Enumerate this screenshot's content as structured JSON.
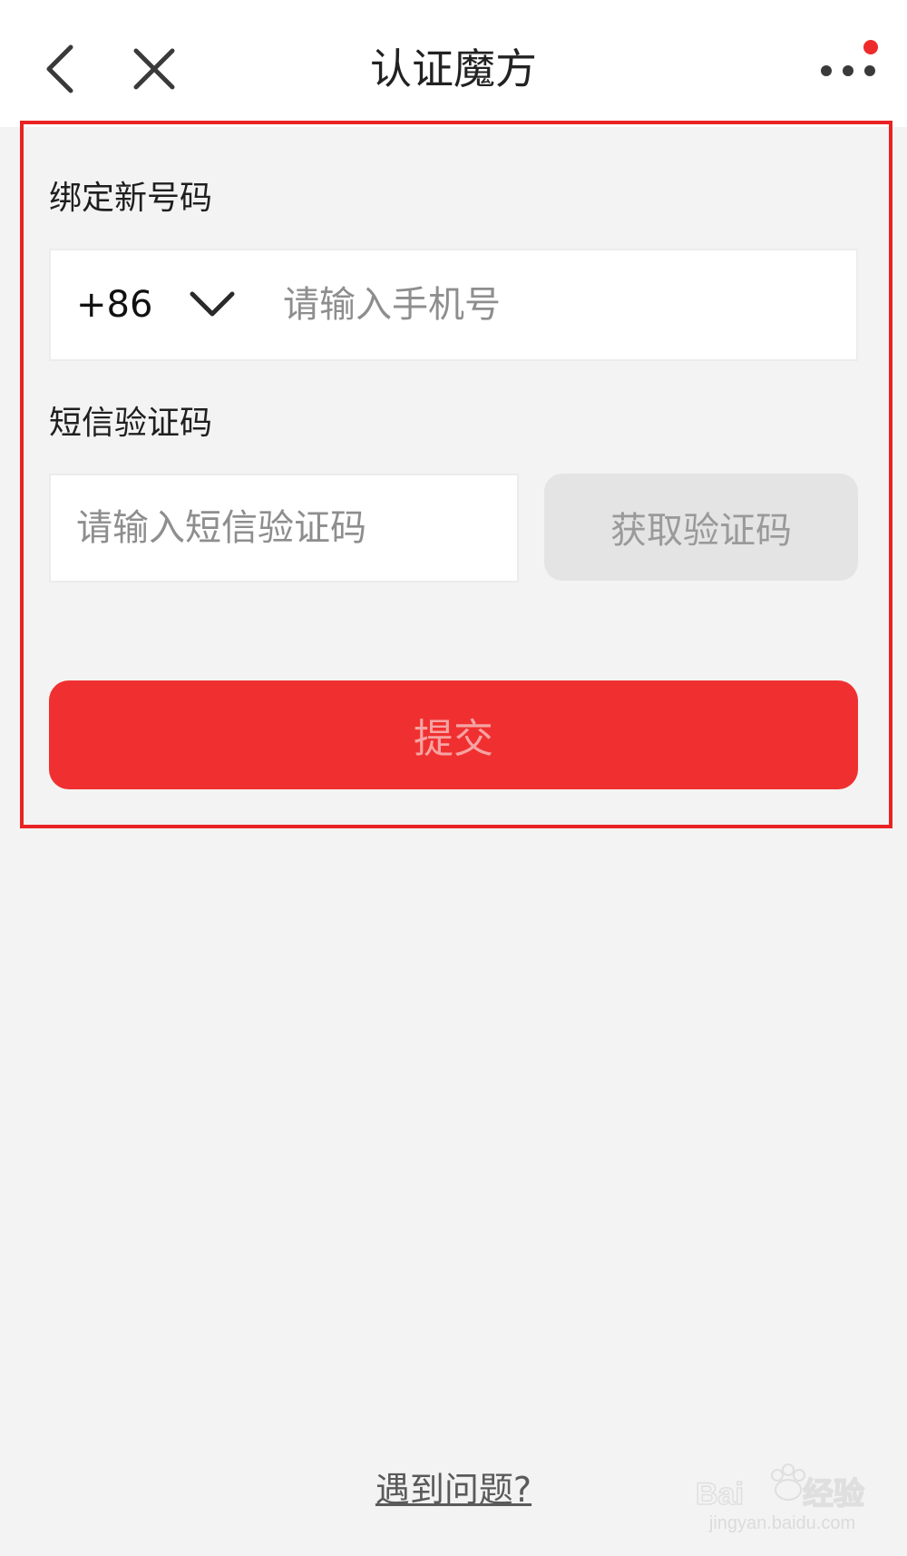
{
  "header": {
    "title": "认证魔方"
  },
  "form": {
    "phone_label": "绑定新号码",
    "country_code": "+86",
    "phone_placeholder": "请输入手机号",
    "sms_label": "短信验证码",
    "sms_placeholder": "请输入短信验证码",
    "get_code_label": "获取验证码",
    "submit_label": "提交"
  },
  "footer": {
    "help_link": "遇到问题?"
  },
  "watermark": {
    "logo_text": "Baidu经验",
    "url": "jingyan.baidu.com"
  },
  "colors": {
    "accent_red": "#f03030",
    "submit_text": "#f6a3a3",
    "get_code_bg": "#e4e4e4",
    "get_code_text": "#9a9a9a",
    "notify_dot": "#ee2b2b",
    "highlight_frame": "#e92323"
  },
  "icons": {
    "back": "chevron-left-icon",
    "close": "close-icon",
    "more": "more-dots-icon",
    "country_dropdown": "chevron-down-icon"
  }
}
